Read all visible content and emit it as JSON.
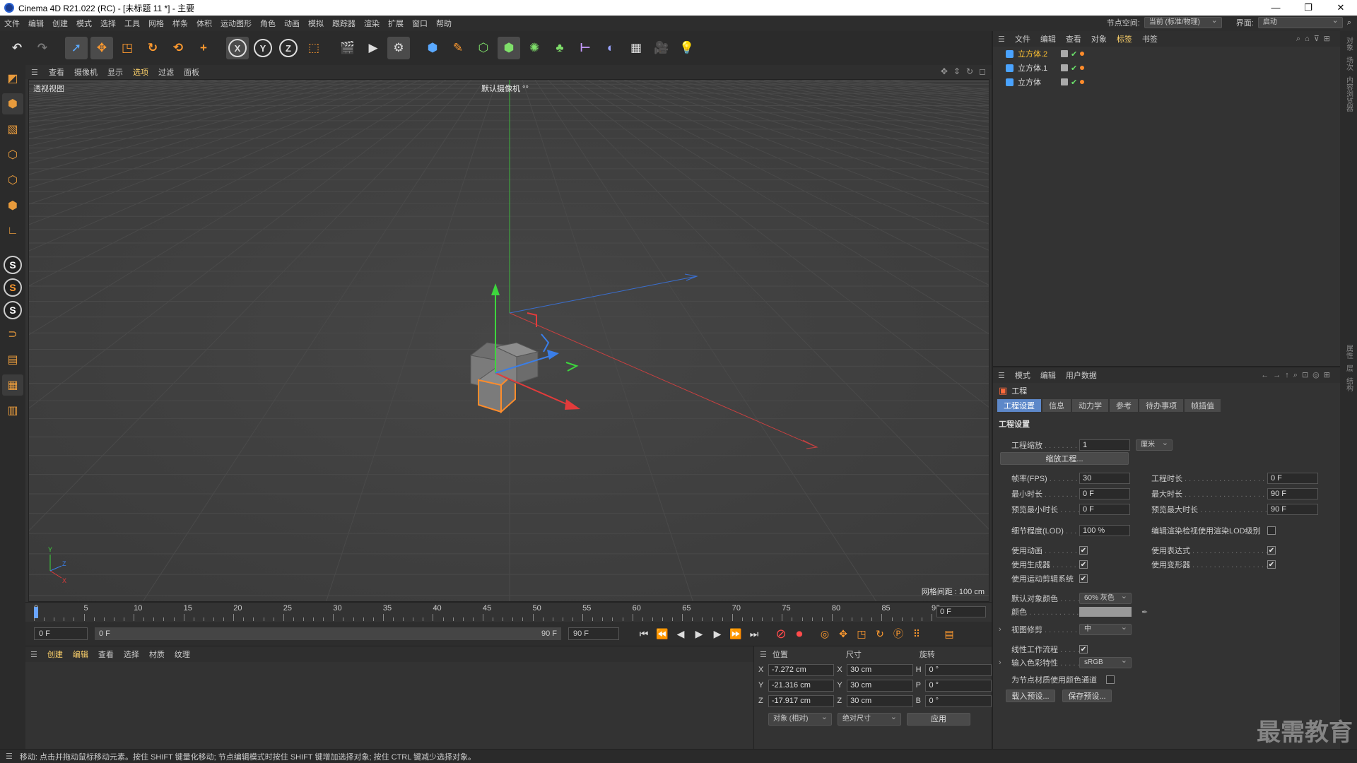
{
  "window": {
    "title": "Cinema 4D R21.022 (RC) - [未标题 11 *] - 主要",
    "min": "—",
    "max": "❐",
    "close": "✕"
  },
  "menubar": {
    "items": [
      "文件",
      "编辑",
      "创建",
      "模式",
      "选择",
      "工具",
      "网格",
      "样条",
      "体积",
      "运动图形",
      "角色",
      "动画",
      "模拟",
      "跟踪器",
      "渲染",
      "扩展",
      "窗口",
      "帮助"
    ],
    "node_space_label": "节点空间:",
    "node_space_value": "当前 (标准/物理)",
    "interface_label": "界面:",
    "interface_value": "启动"
  },
  "viewport": {
    "menu": [
      "查看",
      "摄像机",
      "显示",
      "选项",
      "过滤",
      "面板"
    ],
    "label": "透视视图",
    "camera": "默认摄像机 °°",
    "grid_spacing": "网格间距 : 100 cm"
  },
  "timeline": {
    "ticks": [
      "0",
      "5",
      "10",
      "15",
      "20",
      "25",
      "30",
      "35",
      "40",
      "45",
      "50",
      "55",
      "60",
      "65",
      "70",
      "75",
      "80",
      "85",
      "90"
    ],
    "current_frame": "0 F"
  },
  "transport": {
    "start": "0 F",
    "range_start": "0 F",
    "range_end": "90 F",
    "end": "90 F"
  },
  "material_manager": {
    "menu": [
      "创建",
      "编辑",
      "查看",
      "选择",
      "材质",
      "纹理"
    ]
  },
  "coords": {
    "headers": {
      "position": "位置",
      "size": "尺寸",
      "rotation": "旋转"
    },
    "rows": [
      {
        "ax": "X",
        "pos": "-7.272 cm",
        "sax": "X",
        "size": "30 cm",
        "rax": "H",
        "rot": "0 °"
      },
      {
        "ax": "Y",
        "pos": "-21.316 cm",
        "sax": "Y",
        "size": "30 cm",
        "rax": "P",
        "rot": "0 °"
      },
      {
        "ax": "Z",
        "pos": "-17.917 cm",
        "sax": "Z",
        "size": "30 cm",
        "rax": "B",
        "rot": "0 °"
      }
    ],
    "mode": "对象 (相对)",
    "size_mode": "绝对尺寸",
    "apply": "应用"
  },
  "object_manager": {
    "menu": [
      "文件",
      "编辑",
      "查看",
      "对象",
      "标签",
      "书签"
    ],
    "objects": [
      "立方体.2",
      "立方体.1",
      "立方体"
    ]
  },
  "attribute_manager": {
    "menu": [
      "模式",
      "编辑",
      "用户数据"
    ],
    "object": "工程",
    "tabs": [
      "工程设置",
      "信息",
      "动力学",
      "参考",
      "待办事项",
      "帧插值"
    ],
    "section": "工程设置",
    "project_scale_label": "工程缩放",
    "project_scale_value": "1",
    "project_scale_unit": "厘米",
    "scale_project_button": "缩放工程...",
    "fps_label": "帧率(FPS)",
    "fps_value": "30",
    "project_time_label": "工程时长",
    "project_time_value": "0 F",
    "min_time_label": "最小时长",
    "min_time_value": "0 F",
    "max_time_label": "最大时长",
    "max_time_value": "90 F",
    "preview_min_label": "预览最小时长",
    "preview_min_value": "0 F",
    "preview_max_label": "预览最大时长",
    "preview_max_value": "90 F",
    "lod_label": "细节程度(LOD)",
    "lod_value": "100 %",
    "render_lod_label": "编辑渲染检视使用渲染LOD级别",
    "use_animation_label": "使用动画",
    "use_expression_label": "使用表达式",
    "use_generator_label": "使用生成器",
    "use_deformer_label": "使用变形器",
    "use_mograph_label": "使用运动剪辑系统",
    "default_color_label": "默认对象颜色",
    "default_color_value": "60% 灰色",
    "color_label": "颜色",
    "view_clip_label": "视图修剪",
    "view_clip_value": "中",
    "linear_workflow_label": "线性工作流程",
    "input_color_label": "输入色彩特性",
    "input_color_value": "sRGB",
    "node_material_label": "为节点材质使用颜色通道",
    "load_preset": "载入预设...",
    "save_preset": "保存预设..."
  },
  "statusbar": {
    "text": "移动: 点击并拖动鼠标移动元素。按住 SHIFT 键量化移动; 节点编辑模式时按住 SHIFT 键增加选择对象; 按住 CTRL 键减少选择对象。"
  },
  "right_strip": [
    "对象",
    "场次",
    "内容浏览器",
    "属性",
    "层",
    "结构"
  ],
  "watermark": "最需教育"
}
